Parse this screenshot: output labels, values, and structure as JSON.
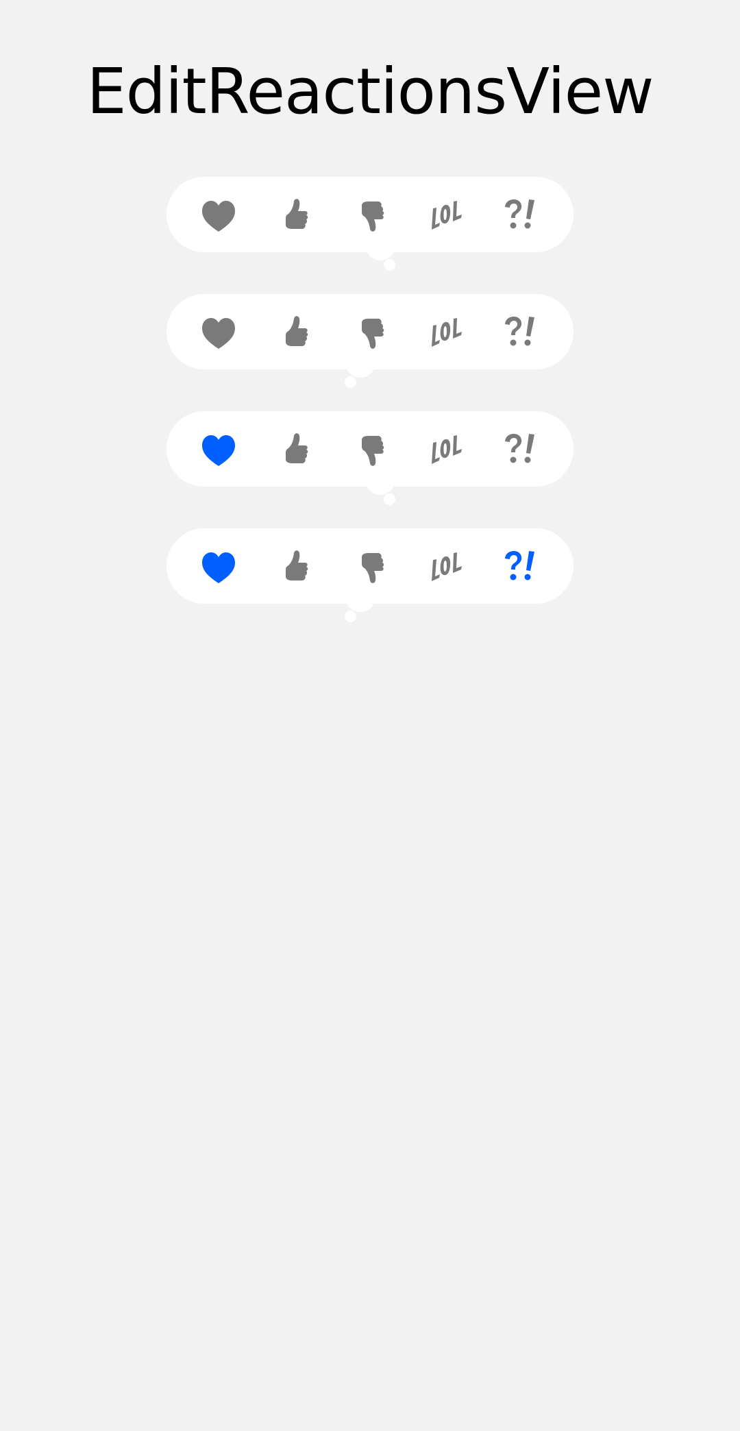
{
  "title": "EditReactionsView",
  "colors": {
    "background": "#f2f2f2",
    "bar": "#ffffff",
    "inactive": "#7a7a7a",
    "active": "#005fff"
  },
  "reaction_types": [
    "heart",
    "thumbs-up",
    "thumbs-down",
    "lol",
    "interrobang"
  ],
  "bars": [
    {
      "selected": [],
      "tail": "right"
    },
    {
      "selected": [],
      "tail": "left"
    },
    {
      "selected": [
        "heart"
      ],
      "tail": "right"
    },
    {
      "selected": [
        "heart",
        "interrobang"
      ],
      "tail": "left"
    }
  ]
}
